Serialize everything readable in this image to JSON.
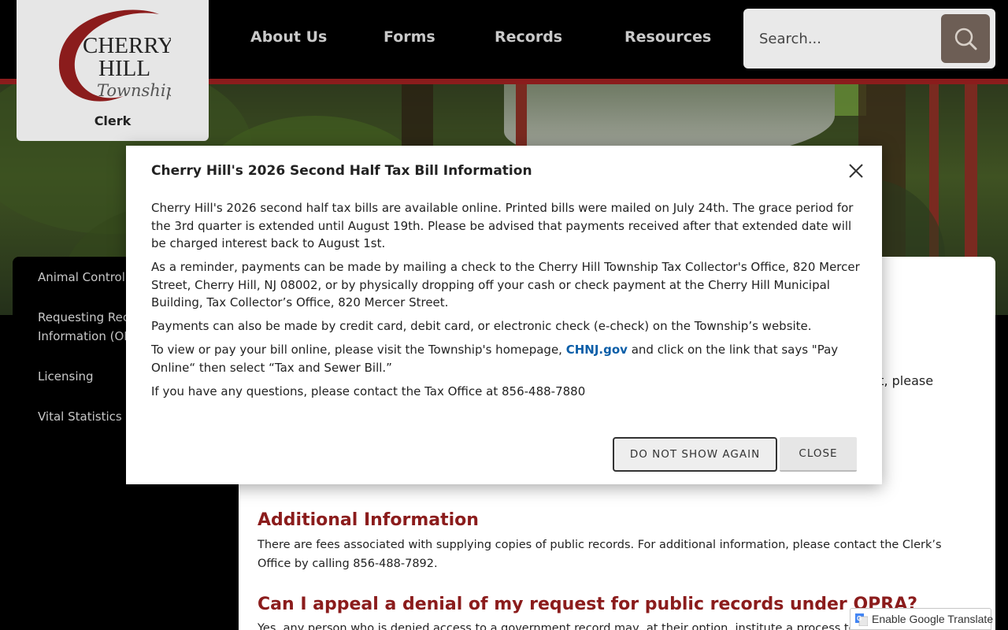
{
  "header": {
    "logo": {
      "line1": "CHERRY",
      "line2": "HILL",
      "line3": "Township"
    },
    "department": "Clerk",
    "nav": [
      "About Us",
      "Forms",
      "Records",
      "Resources"
    ],
    "search": {
      "placeholder": "Search..."
    }
  },
  "sidebar": {
    "items": [
      "Animal Control",
      "Requesting Reco",
      "Information (OP",
      "Licensing",
      "Vital Statistics"
    ]
  },
  "content": {
    "peek_right": "est, please",
    "peek_left": "",
    "sections": [
      {
        "heading": "Additional Information",
        "text": "There are fees associated with supplying copies of public records. For additional information, please contact the Clerk’s Office by calling 856-488-7892."
      },
      {
        "heading": "Can I appeal a denial of my request for public records under OPRA?",
        "text": "Yes, any person who is denied access to a government record may, at their option, institute a process to appeal th"
      }
    ]
  },
  "translate": {
    "label": "Enable Google Translate"
  },
  "modal": {
    "title": "Cherry Hill's 2026 Second Half Tax Bill Information",
    "paragraphs": [
      "Cherry Hill's 2026 second half tax bills are available online. Printed bills were mailed on July 24th.  The grace period for the 3rd quarter is extended until August 19th. Please be advised that payments received after that extended date will be charged interest back to August 1st.",
      "As a reminder, payments can be made by mailing a check to the Cherry Hill Township Tax Collector's Office, 820 Mercer Street, Cherry Hill, NJ 08002, or by physically dropping off your cash or check payment at the Cherry Hill Municipal Building, Tax Collector’s Office, 820 Mercer Street.",
      "Payments can also be made by credit card, debit card, or electronic check (e-check) on the Township’s website."
    ],
    "link_para": {
      "before": "To view or pay your bill online, please visit the Township's homepage, ",
      "link": "CHNJ.gov",
      "after": " and click on the link that says \"Pay Online“ then select “Tax and Sewer Bill.”"
    },
    "last_para": "If you have any questions, please contact the Tax Office at 856-488-7880",
    "buttons": {
      "dont_show": "DO NOT SHOW AGAIN",
      "close": "CLOSE"
    }
  },
  "colors": {
    "brand_red": "#8b1c1c",
    "link_blue": "#0b5ea8",
    "search_button": "#6d5e55"
  }
}
